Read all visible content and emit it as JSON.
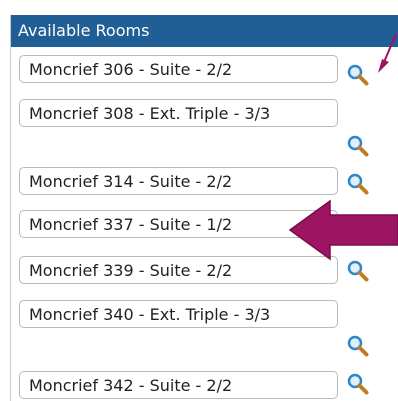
{
  "header": {
    "title": "Available Rooms"
  },
  "rooms": [
    {
      "label": "Moncrief 306 - Suite - 2/2"
    },
    {
      "label": "Moncrief 308 - Ext. Triple - 3/3"
    },
    {
      "label": "Moncrief 314 - Suite - 2/2"
    },
    {
      "label": "Moncrief 337 - Suite - 1/2"
    },
    {
      "label": "Moncrief 339 - Suite - 2/2"
    },
    {
      "label": "Moncrief 340 - Ext. Triple - 3/3"
    },
    {
      "label": "Moncrief 342 - Suite - 2/2"
    }
  ],
  "icons": {
    "room_details": "magnifying-glass-icon",
    "annotation_small": "arrow-icon",
    "annotation_large": "arrow-icon"
  },
  "colors": {
    "header_bg": "#1f5f96",
    "annotation_arrow": "#9c1462"
  }
}
